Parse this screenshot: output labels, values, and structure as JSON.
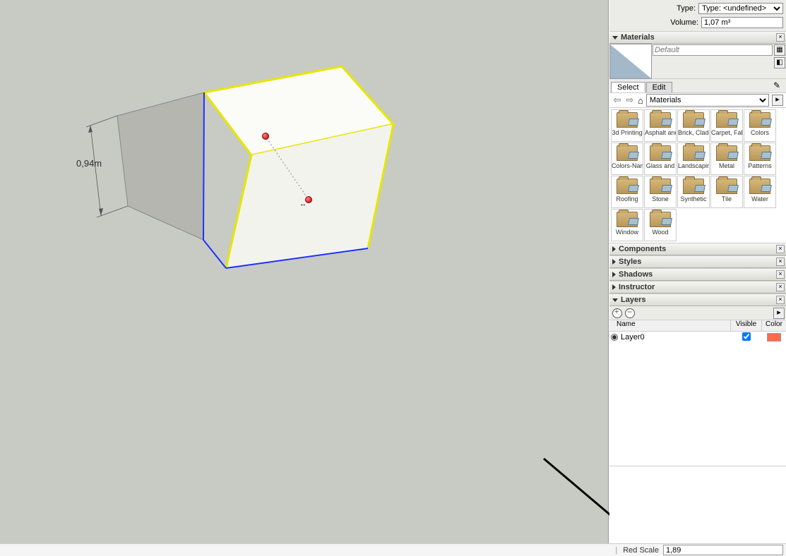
{
  "entity_info": {
    "type_label": "Type:",
    "type_value": "Type: <undefined>",
    "volume_label": "Volume:",
    "volume_value": "1,07 m³"
  },
  "panels": {
    "materials": {
      "title": "Materials",
      "expanded": true
    },
    "components": {
      "title": "Components",
      "expanded": false
    },
    "styles": {
      "title": "Styles",
      "expanded": false
    },
    "shadows": {
      "title": "Shadows",
      "expanded": false
    },
    "instructor": {
      "title": "Instructor",
      "expanded": false
    },
    "layers": {
      "title": "Layers",
      "expanded": true
    }
  },
  "materials": {
    "current_name": "Default",
    "tabs": {
      "select": "Select",
      "edit": "Edit"
    },
    "combo_value": "Materials",
    "folders": [
      "3d Printing",
      "Asphalt and",
      "Brick, Cladding",
      "Carpet, Fabric",
      "Colors",
      "Colors-Named",
      "Glass and",
      "Landscaping",
      "Metal",
      "Patterns",
      "Roofing",
      "Stone",
      "Synthetic",
      "Tile",
      "Water",
      "Window",
      "Wood"
    ]
  },
  "layers": {
    "columns": {
      "name": "Name",
      "visible": "Visible",
      "color": "Color"
    },
    "rows": [
      {
        "name": "Layer0",
        "visible": true,
        "color": "#ff6a4d",
        "active": true
      }
    ]
  },
  "viewport": {
    "dimension": "0,94m"
  },
  "status": {
    "label": "Red Scale",
    "value": "1,89"
  },
  "icons": {
    "create": "✚",
    "sample": "◧",
    "eyedropper": "✎",
    "details": "▸"
  }
}
